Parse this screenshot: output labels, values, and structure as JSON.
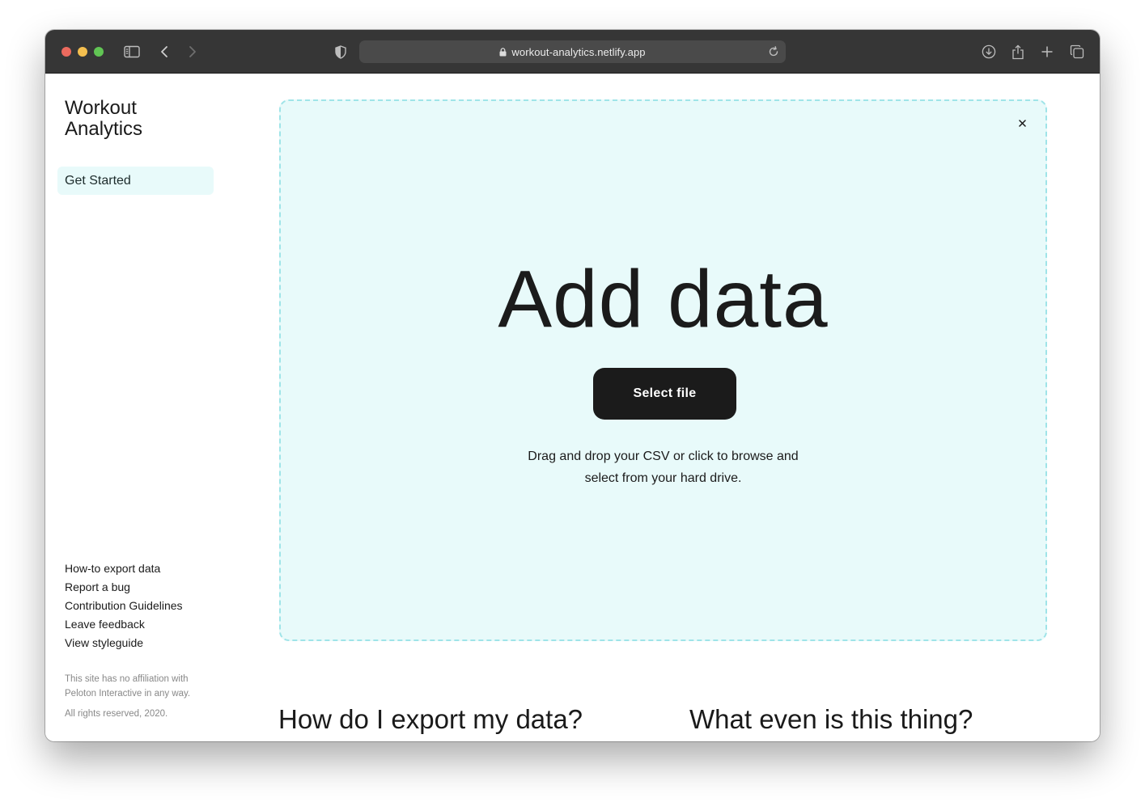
{
  "browser": {
    "url": "workout-analytics.netlify.app",
    "icons": [
      "sidebar-icon",
      "back-icon",
      "forward-icon",
      "shield-icon",
      "lock-icon",
      "reload-icon",
      "download-icon",
      "share-icon",
      "new-tab-icon",
      "tabs-icon"
    ]
  },
  "sidebar": {
    "brand": "Workout Analytics",
    "nav": [
      {
        "label": "Get Started",
        "active": true
      }
    ],
    "footer_links": [
      "How-to export data",
      "Report a bug",
      "Contribution Guidelines",
      "Leave feedback",
      "View styleguide"
    ],
    "disclaimer": "This site has no affiliation with Peloton Interactive in any way.",
    "copyright": "All rights reserved, 2020."
  },
  "dropzone": {
    "close_label": "×",
    "title": "Add data",
    "button_label": "Select file",
    "hint_line1": "Drag and drop your CSV or click to browse and",
    "hint_line2": "select from your hard drive."
  },
  "faq": {
    "headings": [
      "How do I export my data?",
      "What even is this thing?"
    ]
  },
  "colors": {
    "accent_bg": "#e8fafa",
    "dropzone_border": "#9fe4e8",
    "button_bg": "#1b1b1b",
    "titlebar": "#363636"
  }
}
